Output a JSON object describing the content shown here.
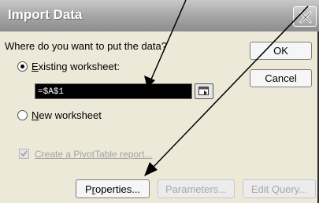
{
  "dialog": {
    "title": "Import Data",
    "prompt": "Where do you want to put the data?",
    "options": {
      "existing_prefix": "",
      "existing_mnemonic": "E",
      "existing_rest": "xisting worksheet:",
      "existing_selected": true,
      "cell_reference": "=$A$1",
      "new_mnemonic": "N",
      "new_rest": "ew worksheet",
      "new_selected": false
    },
    "pivot": {
      "label": "Create a PivotTable report...",
      "enabled": false
    },
    "buttons": {
      "ok": "OK",
      "cancel": "Cancel",
      "properties_prefix": "P",
      "properties_mnemonic": "r",
      "properties_rest": "operties...",
      "parameters": "Parameters...",
      "edit_query": "Edit Query..."
    }
  },
  "icons": {
    "close": "close-x-icon",
    "collapse": "collapse-dialog-icon",
    "pivot": "pivot-checkbox-icon"
  },
  "colors": {
    "dialog_bg": "#ece9d8",
    "title_bar": "#a9a9a9",
    "field_bg": "#000000",
    "arrow": "#000000",
    "disabled_text": "#a3a3a3"
  }
}
